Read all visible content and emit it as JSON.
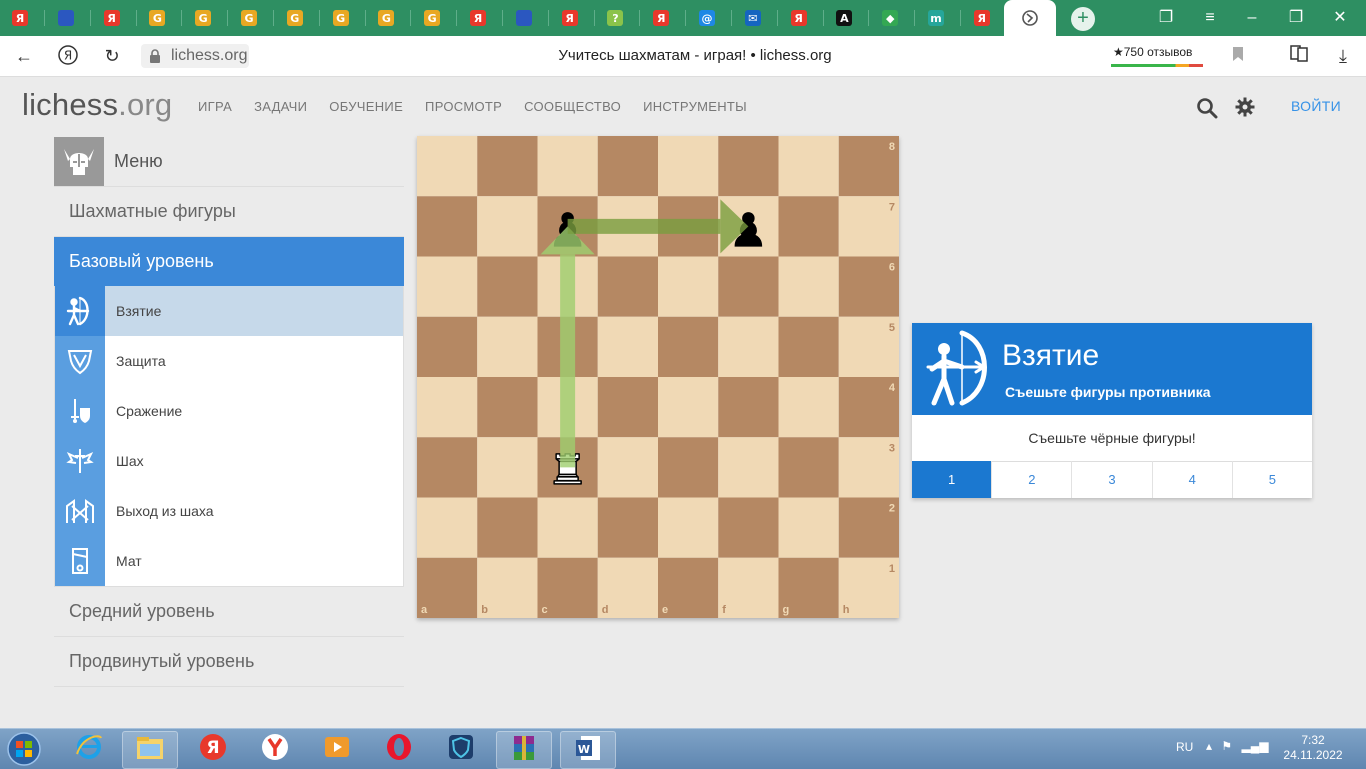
{
  "browser": {
    "active_tab_icon": "lichess-icon",
    "tabs": [
      {
        "icon": "yandex-icon",
        "letter": "Я",
        "color": "#e8382b"
      },
      {
        "icon": "flag-ru-icon",
        "letter": "",
        "color": "#2b57c0"
      },
      {
        "icon": "yandex-icon",
        "letter": "Я",
        "color": "#e8382b"
      },
      {
        "icon": "gz-icon",
        "letter": "G",
        "color": "#e8a823"
      },
      {
        "icon": "gz-icon",
        "letter": "G",
        "color": "#e8a823"
      },
      {
        "icon": "gz-icon",
        "letter": "G",
        "color": "#e8a823"
      },
      {
        "icon": "gz-icon",
        "letter": "G",
        "color": "#e8a823"
      },
      {
        "icon": "gz-icon",
        "letter": "G",
        "color": "#e8a823"
      },
      {
        "icon": "gz-icon",
        "letter": "G",
        "color": "#e8a823"
      },
      {
        "icon": "gz-icon",
        "letter": "G",
        "color": "#e8a823"
      },
      {
        "icon": "yandex-icon",
        "letter": "Я",
        "color": "#e8382b"
      },
      {
        "icon": "flag-ru-icon",
        "letter": "",
        "color": "#2b57c0"
      },
      {
        "icon": "yandex-icon",
        "letter": "Я",
        "color": "#e8382b"
      },
      {
        "icon": "question-icon",
        "letter": "?",
        "color": "#8bc34a"
      },
      {
        "icon": "yandex-icon",
        "letter": "Я",
        "color": "#e8382b"
      },
      {
        "icon": "at-icon",
        "letter": "@",
        "color": "#1e88e5"
      },
      {
        "icon": "mail-icon",
        "letter": "✉",
        "color": "#1565c0"
      },
      {
        "icon": "yandex-icon",
        "letter": "Я",
        "color": "#e8382b"
      },
      {
        "icon": "a-icon",
        "letter": "A",
        "color": "#111111"
      },
      {
        "icon": "drive-icon",
        "letter": "◆",
        "color": "#34a853"
      },
      {
        "icon": "m-icon",
        "letter": "m",
        "color": "#26a69a"
      },
      {
        "icon": "yandex-icon",
        "letter": "Я",
        "color": "#e8382b"
      }
    ],
    "url": "lichess.org",
    "page_title": "Учитесь шахматам - играя! • lichess.org",
    "reviews": "★750 отзывов"
  },
  "site": {
    "logo_main": "lichess",
    "logo_tld": ".org",
    "nav": [
      "ИГРА",
      "ЗАДАЧИ",
      "ОБУЧЕНИЕ",
      "ПРОСМОТР",
      "СООБЩЕСТВО",
      "ИНСТРУМЕНТЫ"
    ],
    "login": "ВОЙТИ"
  },
  "menu": {
    "title": "Меню",
    "categories": {
      "pieces": "Шахматные фигуры",
      "basic": "Базовый уровень",
      "intermediate": "Средний уровень",
      "advanced": "Продвинутый уровень"
    },
    "stages": [
      {
        "label": "Взятие",
        "icon": "archer-icon",
        "active": true
      },
      {
        "label": "Защита",
        "icon": "shield-icon",
        "active": false
      },
      {
        "label": "Сражение",
        "icon": "knight-sword-icon",
        "active": false
      },
      {
        "label": "Шах",
        "icon": "winged-sword-icon",
        "active": false
      },
      {
        "label": "Выход из шаха",
        "icon": "escape-icon",
        "active": false
      },
      {
        "label": "Мат",
        "icon": "guillotine-icon",
        "active": false
      }
    ]
  },
  "board": {
    "files": [
      "a",
      "b",
      "c",
      "d",
      "e",
      "f",
      "g",
      "h"
    ],
    "ranks": [
      "8",
      "7",
      "6",
      "5",
      "4",
      "3",
      "2",
      "1"
    ],
    "light_color": "#f0d9b5",
    "dark_color": "#b58863",
    "pieces": [
      {
        "square": "c7",
        "piece": "pawn",
        "color": "black"
      },
      {
        "square": "f7",
        "piece": "pawn",
        "color": "black"
      },
      {
        "square": "c3",
        "piece": "rook",
        "color": "white"
      }
    ],
    "arrows": [
      {
        "from": "c3",
        "to": "c7",
        "color": "#9fcf6f"
      },
      {
        "from": "c7",
        "to": "f7",
        "color": "#7a9e3f"
      }
    ]
  },
  "lesson": {
    "title": "Взятие",
    "subtitle": "Съешьте фигуры противника",
    "goal": "Съешьте чёрные фигуры!",
    "levels": [
      "1",
      "2",
      "3",
      "4",
      "5"
    ],
    "active_level": 1,
    "header_color": "#1b78d0"
  },
  "taskbar": {
    "apps": [
      {
        "name": "ie-icon"
      },
      {
        "name": "explorer-icon"
      },
      {
        "name": "yandex-icon"
      },
      {
        "name": "yandex-browser-icon"
      },
      {
        "name": "video-player-icon"
      },
      {
        "name": "opera-icon"
      },
      {
        "name": "shield-app-icon"
      },
      {
        "name": "winrar-icon"
      },
      {
        "name": "word-icon"
      }
    ],
    "lang": "RU",
    "time": "7:32",
    "date": "24.11.2022"
  }
}
